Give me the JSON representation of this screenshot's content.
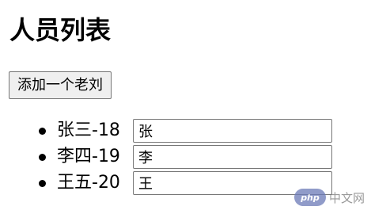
{
  "page": {
    "title": "人员列表",
    "add_button_label": "添加一个老刘"
  },
  "people": [
    {
      "label": "张三-18",
      "input_value": "张"
    },
    {
      "label": "李四-19",
      "input_value": "李"
    },
    {
      "label": "王五-20",
      "input_value": "王"
    }
  ],
  "watermark": {
    "logo_text": "php",
    "site_text": "中文网"
  }
}
